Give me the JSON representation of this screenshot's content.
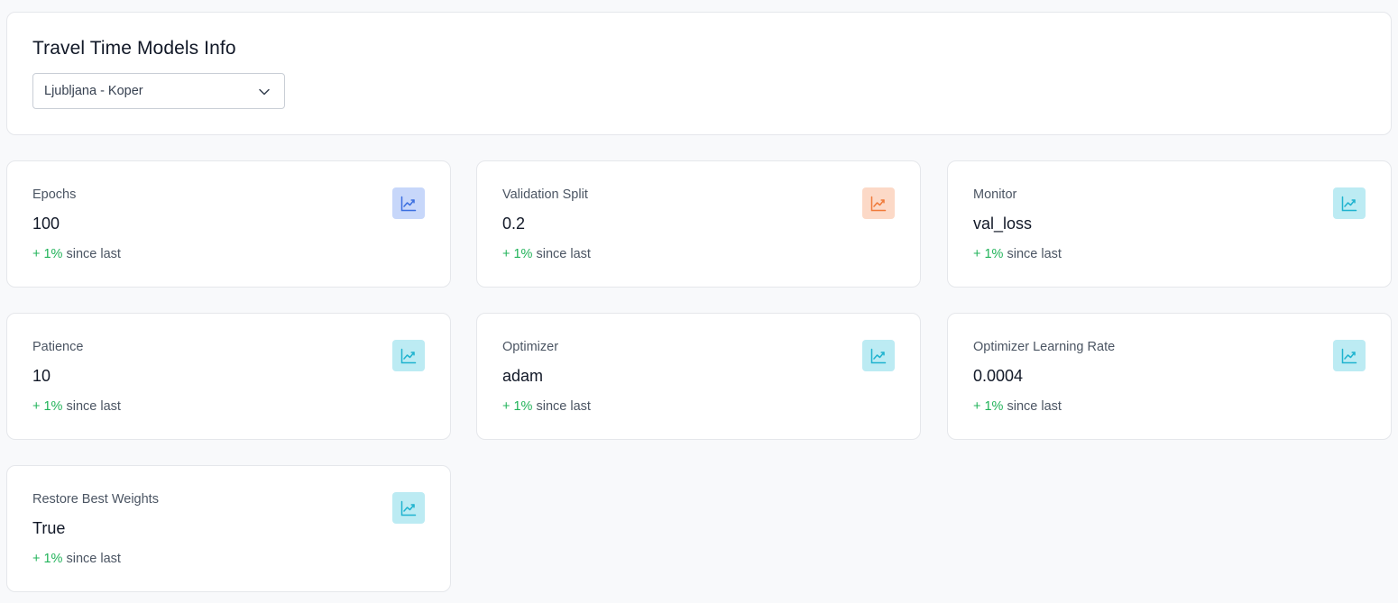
{
  "header": {
    "title": "Travel Time Models Info",
    "route_select": {
      "value": "Ljubljana - Koper",
      "icon": "chevron-down-icon"
    }
  },
  "stats": [
    {
      "label": "Epochs",
      "value": "100",
      "delta": "+ 1%",
      "since": "since last",
      "icon": "chart-line-icon",
      "icon_color": "#3b6fe0",
      "icon_bg": "#c7d7fa"
    },
    {
      "label": "Validation Split",
      "value": "0.2",
      "delta": "+ 1%",
      "since": "since last",
      "icon": "chart-line-icon",
      "icon_color": "#f07a3a",
      "icon_bg": "#fcd9c7"
    },
    {
      "label": "Monitor",
      "value": "val_loss",
      "delta": "+ 1%",
      "since": "since last",
      "icon": "chart-line-icon",
      "icon_color": "#1fb3cf",
      "icon_bg": "#bcebf3"
    },
    {
      "label": "Patience",
      "value": "10",
      "delta": "+ 1%",
      "since": "since last",
      "icon": "chart-line-icon",
      "icon_color": "#1fb3cf",
      "icon_bg": "#bcebf3"
    },
    {
      "label": "Optimizer",
      "value": "adam",
      "delta": "+ 1%",
      "since": "since last",
      "icon": "chart-line-icon",
      "icon_color": "#1fb3cf",
      "icon_bg": "#bcebf3"
    },
    {
      "label": "Optimizer Learning Rate",
      "value": "0.0004",
      "delta": "+ 1%",
      "since": "since last",
      "icon": "chart-line-icon",
      "icon_color": "#1fb3cf",
      "icon_bg": "#bcebf3"
    },
    {
      "label": "Restore Best Weights",
      "value": "True",
      "delta": "+ 1%",
      "since": "since last",
      "icon": "chart-line-icon",
      "icon_color": "#1fb3cf",
      "icon_bg": "#bcebf3"
    }
  ],
  "colors": {
    "positive": "#22b35a",
    "background": "#f8f9fb",
    "card": "#ffffff"
  }
}
